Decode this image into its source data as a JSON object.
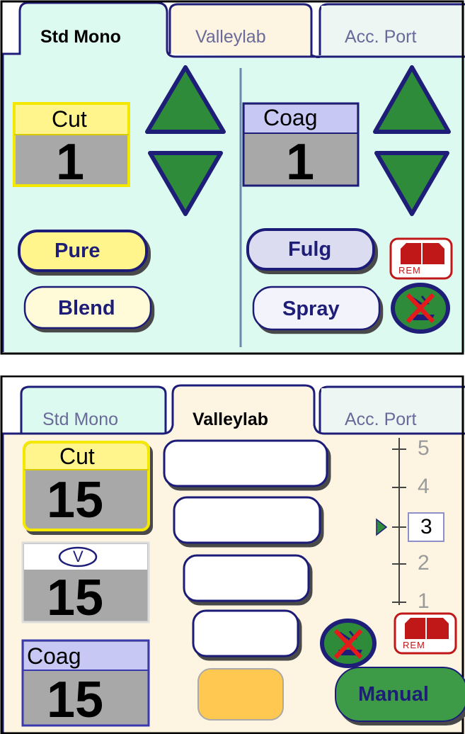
{
  "panel1": {
    "tabs": [
      {
        "label": "Std Mono",
        "active": true
      },
      {
        "label": "Valleylab",
        "active": false
      },
      {
        "label": "Acc. Port",
        "active": false
      }
    ],
    "cut": {
      "label": "Cut",
      "value": "1"
    },
    "coag": {
      "label": "Coag",
      "value": "1"
    },
    "cut_modes": [
      {
        "label": "Pure",
        "selected": true
      },
      {
        "label": "Blend",
        "selected": false
      }
    ],
    "coag_modes": [
      {
        "label": "Fulg",
        "selected": true
      },
      {
        "label": "Spray",
        "selected": false
      }
    ],
    "rem_label": "REM"
  },
  "panel2": {
    "tabs": [
      {
        "label": "Std Mono",
        "active": false
      },
      {
        "label": "Valleylab",
        "active": true
      },
      {
        "label": "Acc. Port",
        "active": false
      }
    ],
    "cut": {
      "label": "Cut",
      "value": "15"
    },
    "v": {
      "label": "V",
      "value": "15"
    },
    "coag": {
      "label": "Coag",
      "value": "15"
    },
    "levels": [
      "5",
      "4",
      "3",
      "2",
      "1"
    ],
    "selected_level": "3",
    "rem_label": "REM",
    "manual_label": "Manual"
  },
  "colors": {
    "std_bg": "#dcfaf0",
    "valleylab_bg": "#fdf5e1",
    "navy": "#1e1e78",
    "arrow_green": "#2e8b3a",
    "cut_yellow": "#fff58c",
    "coag_blue": "#c8c8f5",
    "value_gray": "#a8a8a8",
    "orange_button": "#ffc850",
    "manual_green": "#3c9b46"
  }
}
